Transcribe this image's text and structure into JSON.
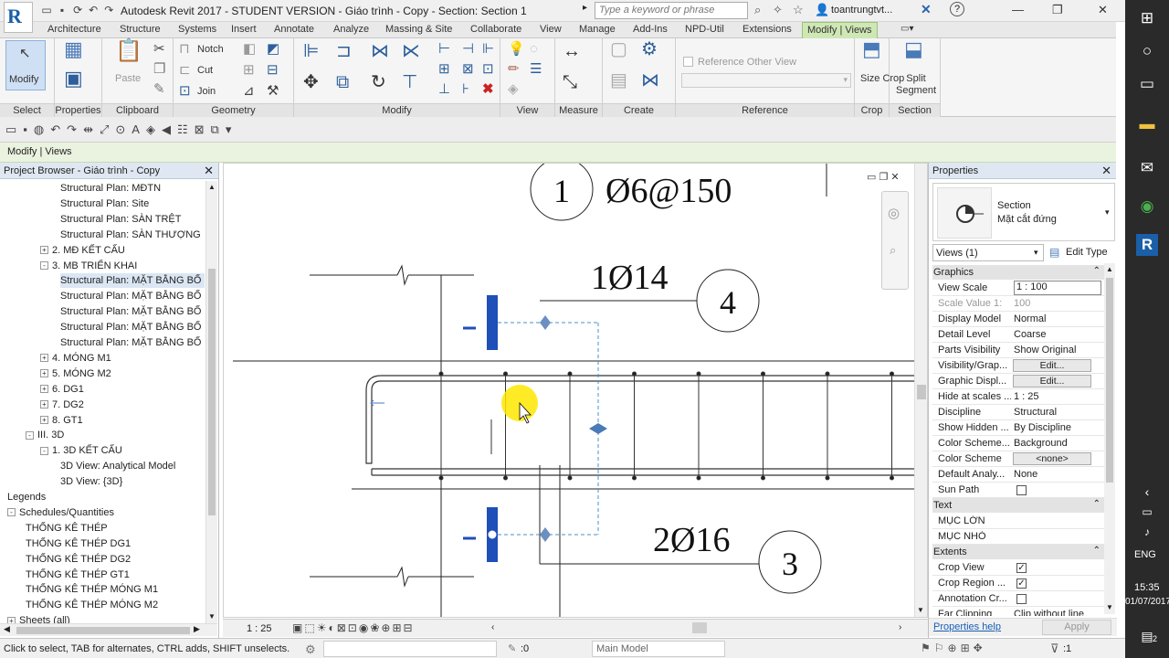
{
  "app": {
    "title": "Autodesk Revit 2017 - STUDENT VERSION -    Giáo trình - Copy - Section: Section 1",
    "search_placeholder": "Type a keyword or phrase",
    "user": "toantrungtvt..."
  },
  "tabs": [
    "Architecture",
    "Structure",
    "Systems",
    "Insert",
    "Annotate",
    "Analyze",
    "Massing & Site",
    "Collaborate",
    "View",
    "Manage",
    "Add-Ins",
    "NPD-Util",
    "Extensions"
  ],
  "active_tab": "Modify | Views",
  "ribbon": {
    "modify_label": "Modify",
    "properties_label": "Properties",
    "paste_label": "Paste",
    "notch_label": "Notch",
    "cut_label": "Cut",
    "join_label": "Join",
    "reference_other_view": "Reference Other View",
    "size_crop_label": "Size Crop",
    "split_segment_label": "Split Segment",
    "panels": [
      "Select",
      "Properties",
      "Clipboard",
      "Geometry",
      "Modify",
      "View",
      "Measure",
      "Create",
      "Reference",
      "Crop",
      "Section"
    ]
  },
  "option_bar": "Modify | Views",
  "project_browser": {
    "title": "Project Browser - Giáo trình - Copy",
    "items": [
      {
        "label": "Structural Plan: MĐTN",
        "level": 4,
        "exp": ""
      },
      {
        "label": "Structural Plan: Site",
        "level": 4,
        "exp": ""
      },
      {
        "label": "Structural Plan: SÀN TRỆT",
        "level": 4,
        "exp": ""
      },
      {
        "label": "Structural Plan: SÀN THƯỢNG",
        "level": 4,
        "exp": ""
      },
      {
        "label": "2. MĐ KẾT CẤU",
        "level": 3,
        "exp": "+"
      },
      {
        "label": "3. MB TRIỂN KHAI",
        "level": 3,
        "exp": "-"
      },
      {
        "label": "Structural Plan: MẶT BẰNG BỐ",
        "level": 4,
        "exp": "",
        "selected": true
      },
      {
        "label": "Structural Plan: MẶT BẰNG BỐ",
        "level": 4,
        "exp": ""
      },
      {
        "label": "Structural Plan: MẶT BẰNG BỐ",
        "level": 4,
        "exp": ""
      },
      {
        "label": "Structural Plan: MẶT BẰNG BỐ",
        "level": 4,
        "exp": ""
      },
      {
        "label": "Structural Plan: MẶT BẰNG BỐ",
        "level": 4,
        "exp": ""
      },
      {
        "label": "4. MÓNG M1",
        "level": 3,
        "exp": "+"
      },
      {
        "label": "5. MÓNG M2",
        "level": 3,
        "exp": "+"
      },
      {
        "label": "6. DG1",
        "level": 3,
        "exp": "+"
      },
      {
        "label": "7. DG2",
        "level": 3,
        "exp": "+"
      },
      {
        "label": "8. GT1",
        "level": 3,
        "exp": "+"
      },
      {
        "label": "III. 3D",
        "level": 2,
        "exp": "-"
      },
      {
        "label": "1. 3D KẾT CẤU",
        "level": 3,
        "exp": "-"
      },
      {
        "label": "3D View: Analytical Model",
        "level": 4,
        "exp": ""
      },
      {
        "label": "3D View: {3D}",
        "level": 4,
        "exp": ""
      },
      {
        "label": "Legends",
        "level": 1,
        "exp": ""
      },
      {
        "label": "Schedules/Quantities",
        "level": 1,
        "exp": "-"
      },
      {
        "label": "THỐNG KÊ THÉP",
        "level": 2,
        "exp": ""
      },
      {
        "label": "THỐNG KÊ THÉP DG1",
        "level": 2,
        "exp": ""
      },
      {
        "label": "THỐNG KÊ THÉP DG2",
        "level": 2,
        "exp": ""
      },
      {
        "label": "THỐNG KÊ THÉP GT1",
        "level": 2,
        "exp": ""
      },
      {
        "label": "THỐNG KÊ THÉP MÓNG M1",
        "level": 2,
        "exp": ""
      },
      {
        "label": "THỐNG KÊ THÉP MÓNG M2",
        "level": 2,
        "exp": ""
      },
      {
        "label": "Sheets (all)",
        "level": 1,
        "exp": "+"
      }
    ]
  },
  "canvas": {
    "tag1_num": "1",
    "tag1_text": "Ø6@150",
    "tag4_num": "4",
    "tag4_text": "1Ø14",
    "tag3_num": "3",
    "tag3_text": "2Ø16"
  },
  "viewbar": {
    "scale": "1 : 25"
  },
  "properties": {
    "title": "Properties",
    "type_name": "Section",
    "type_sub": "Mặt cắt đứng",
    "selector": "Views (1)",
    "edit_type": "Edit Type",
    "groups": {
      "graphics": "Graphics",
      "text": "Text",
      "extents": "Extents"
    },
    "rows": [
      {
        "k": "View Scale",
        "v": "1 : 100",
        "kind": "input"
      },
      {
        "k": "Scale Value    1:",
        "v": "100",
        "kind": "dim"
      },
      {
        "k": "Display Model",
        "v": "Normal"
      },
      {
        "k": "Detail Level",
        "v": "Coarse"
      },
      {
        "k": "Parts Visibility",
        "v": "Show Original"
      },
      {
        "k": "Visibility/Grap...",
        "v": "Edit...",
        "kind": "btn"
      },
      {
        "k": "Graphic Displ...",
        "v": "Edit...",
        "kind": "btn"
      },
      {
        "k": "Hide at scales ...",
        "v": "1 : 25"
      },
      {
        "k": "Discipline",
        "v": "Structural"
      },
      {
        "k": "Show Hidden ...",
        "v": "By Discipline"
      },
      {
        "k": "Color Scheme...",
        "v": "Background"
      },
      {
        "k": "Color Scheme",
        "v": "<none>",
        "kind": "btn"
      },
      {
        "k": "Default Analy...",
        "v": "None"
      },
      {
        "k": "Sun Path",
        "v": "",
        "kind": "cb"
      }
    ],
    "text_rows": [
      {
        "k": "MỤC LỚN",
        "v": ""
      },
      {
        "k": "MỤC NHỎ",
        "v": ""
      }
    ],
    "extent_rows": [
      {
        "k": "Crop View",
        "v": "✓",
        "kind": "cb"
      },
      {
        "k": "Crop Region ...",
        "v": "✓",
        "kind": "cb"
      },
      {
        "k": "Annotation Cr...",
        "v": "",
        "kind": "cb"
      },
      {
        "k": "Far Clipping",
        "v": "Clip without line"
      }
    ],
    "help": "Properties help",
    "apply": "Apply"
  },
  "status": {
    "hint": "Click to select, TAB for alternates, CTRL adds, SHIFT unselects.",
    "zero": ":0",
    "model": "Main Model",
    "filter": ":1"
  },
  "taskbar": {
    "lang": "ENG",
    "time": "15:35",
    "date": "01/07/2017",
    "notif": "2"
  }
}
